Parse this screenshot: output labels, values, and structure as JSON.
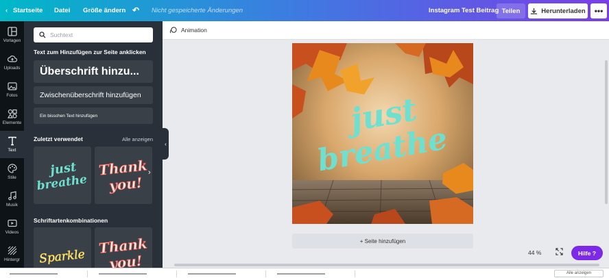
{
  "topbar": {
    "home": "Startseite",
    "file": "Datei",
    "resize": "Größe ändern",
    "unsaved": "Nicht gespeicherte Änderungen",
    "design_title": "Instagram Test Beitrag",
    "share": "Teilen",
    "download": "Herunterladen",
    "more": "•••"
  },
  "rail": [
    {
      "label": "Vorlagen",
      "icon": "layout-icon"
    },
    {
      "label": "Uploads",
      "icon": "cloud-upload-icon"
    },
    {
      "label": "Fotos",
      "icon": "photo-icon"
    },
    {
      "label": "Elemente",
      "icon": "shapes-icon"
    },
    {
      "label": "Text",
      "icon": "text-icon"
    },
    {
      "label": "Stile",
      "icon": "palette-icon"
    },
    {
      "label": "Musik",
      "icon": "music-icon"
    },
    {
      "label": "Videos",
      "icon": "video-icon"
    },
    {
      "label": "Hintergr",
      "icon": "background-icon"
    }
  ],
  "panel": {
    "search_placeholder": "Suchtext",
    "add_text_heading": "Text zum Hinzufügen zur Seite anklicken",
    "heading_btn": "Überschrift hinzu...",
    "subheading_btn": "Zwischenüberschrift hinzufügen",
    "body_btn": "Ein bisschen Text hinzufügen",
    "recent_heading": "Zuletzt verwendet",
    "see_all": "Alle anzeigen",
    "combos_heading": "Schriftartenkombinationen",
    "recent_items": [
      {
        "line1": "just",
        "line2": "breathe"
      },
      {
        "line1": "Thank",
        "line2": "you!"
      }
    ],
    "combo_items": [
      {
        "line1": "Sparkle"
      },
      {
        "line1": "Thank",
        "line2": "you!"
      }
    ]
  },
  "editor": {
    "animation": "Animation",
    "canvas_text_1": "just",
    "canvas_text_2": "breathe",
    "add_page": "+ Seite hinzufügen",
    "zoom": "44 %",
    "help": "Hilfe ?"
  },
  "taskbar": {
    "show_all": "Alle anzeigen"
  },
  "colors": {
    "accent": "#7d2ae8",
    "canvas_text": "#6fe0d0",
    "panel_bg": "#293039",
    "rail_bg": "#0e1318"
  }
}
